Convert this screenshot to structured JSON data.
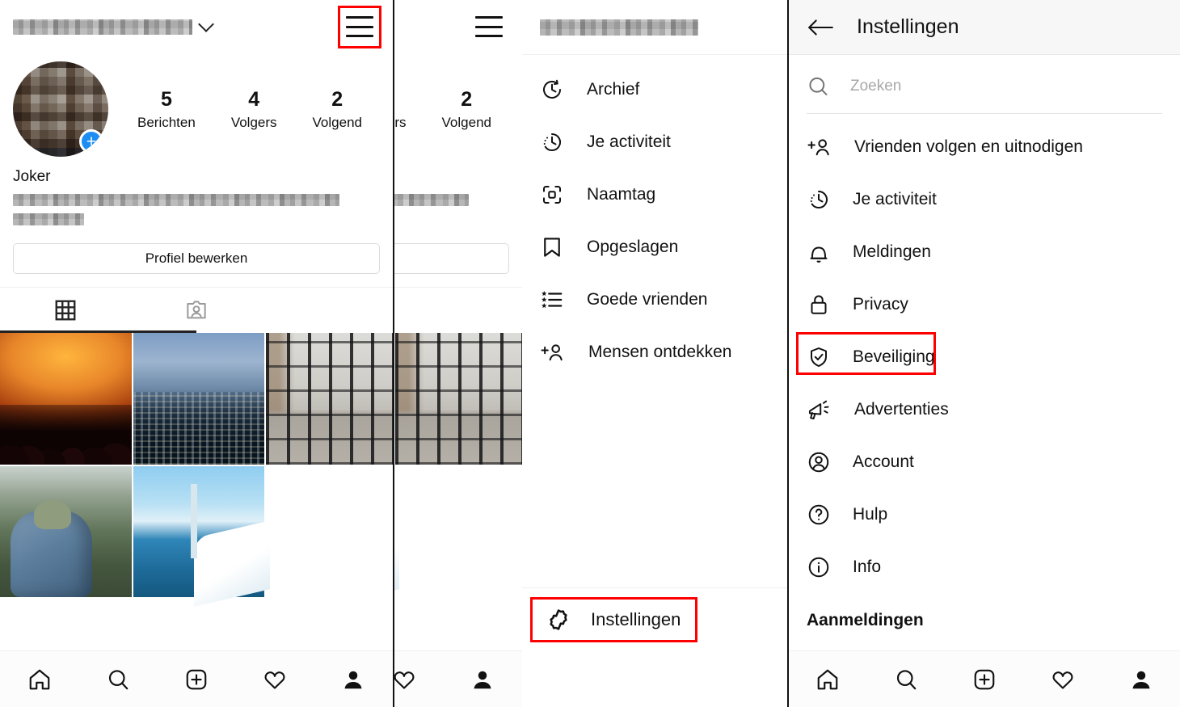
{
  "profile": {
    "username_redacted": true,
    "stats": [
      {
        "num": "5",
        "label": "Berichten"
      },
      {
        "num": "4",
        "label": "Volgers"
      },
      {
        "num": "2",
        "label": "Volgend"
      }
    ],
    "display_name": "Joker",
    "edit_button": "Profiel bewerken",
    "tabs": [
      {
        "name": "grid-tab",
        "icon": "grid-icon",
        "active": true
      },
      {
        "name": "tagged-tab",
        "icon": "tagged-person-icon",
        "active": false
      }
    ],
    "photos": [
      "concert-crowd-photo",
      "city-skyline-photo",
      "office-interior-photo",
      "hiker-backpack-photo",
      "sailing-boat-photo"
    ]
  },
  "profile_partial": {
    "stats": [
      {
        "num": "",
        "label": "ers"
      },
      {
        "num": "2",
        "label": "Volgend"
      }
    ]
  },
  "menu": {
    "header_redacted": true,
    "items": [
      {
        "label": "Archief",
        "icon": "archive-clock-icon"
      },
      {
        "label": "Je activiteit",
        "icon": "activity-clock-icon"
      },
      {
        "label": "Naamtag",
        "icon": "nametag-icon"
      },
      {
        "label": "Opgeslagen",
        "icon": "bookmark-icon"
      },
      {
        "label": "Goede vrienden",
        "icon": "close-friends-list-icon"
      },
      {
        "label": "Mensen ontdekken",
        "icon": "discover-people-icon"
      }
    ],
    "settings_button": "Instellingen",
    "settings_icon": "gear-icon"
  },
  "settings": {
    "title": "Instellingen",
    "back_icon": "back-arrow-icon",
    "search_placeholder": "Zoeken",
    "search_value": "",
    "search_icon": "search-icon",
    "items": [
      {
        "label": "Vrienden volgen en uitnodigen",
        "icon": "add-person-icon"
      },
      {
        "label": "Je activiteit",
        "icon": "activity-clock-icon"
      },
      {
        "label": "Meldingen",
        "icon": "bell-icon"
      },
      {
        "label": "Privacy",
        "icon": "lock-icon"
      },
      {
        "label": "Beveiliging",
        "icon": "shield-check-icon",
        "highlighted": true
      },
      {
        "label": "Advertenties",
        "icon": "megaphone-icon"
      },
      {
        "label": "Account",
        "icon": "account-circle-icon"
      },
      {
        "label": "Hulp",
        "icon": "question-circle-icon"
      },
      {
        "label": "Info",
        "icon": "info-circle-icon"
      }
    ],
    "section_title": "Aanmeldingen"
  },
  "bottom_nav": [
    {
      "icon": "home-icon"
    },
    {
      "icon": "search-icon"
    },
    {
      "icon": "add-post-icon"
    },
    {
      "icon": "heart-icon"
    },
    {
      "icon": "profile-person-icon"
    }
  ],
  "annotations": {
    "highlight_color": "#ff0000",
    "highlights": [
      {
        "target": "hamburger-menu-button"
      },
      {
        "target": "settings-button"
      },
      {
        "target": "settings-item-beveiliging"
      }
    ]
  }
}
